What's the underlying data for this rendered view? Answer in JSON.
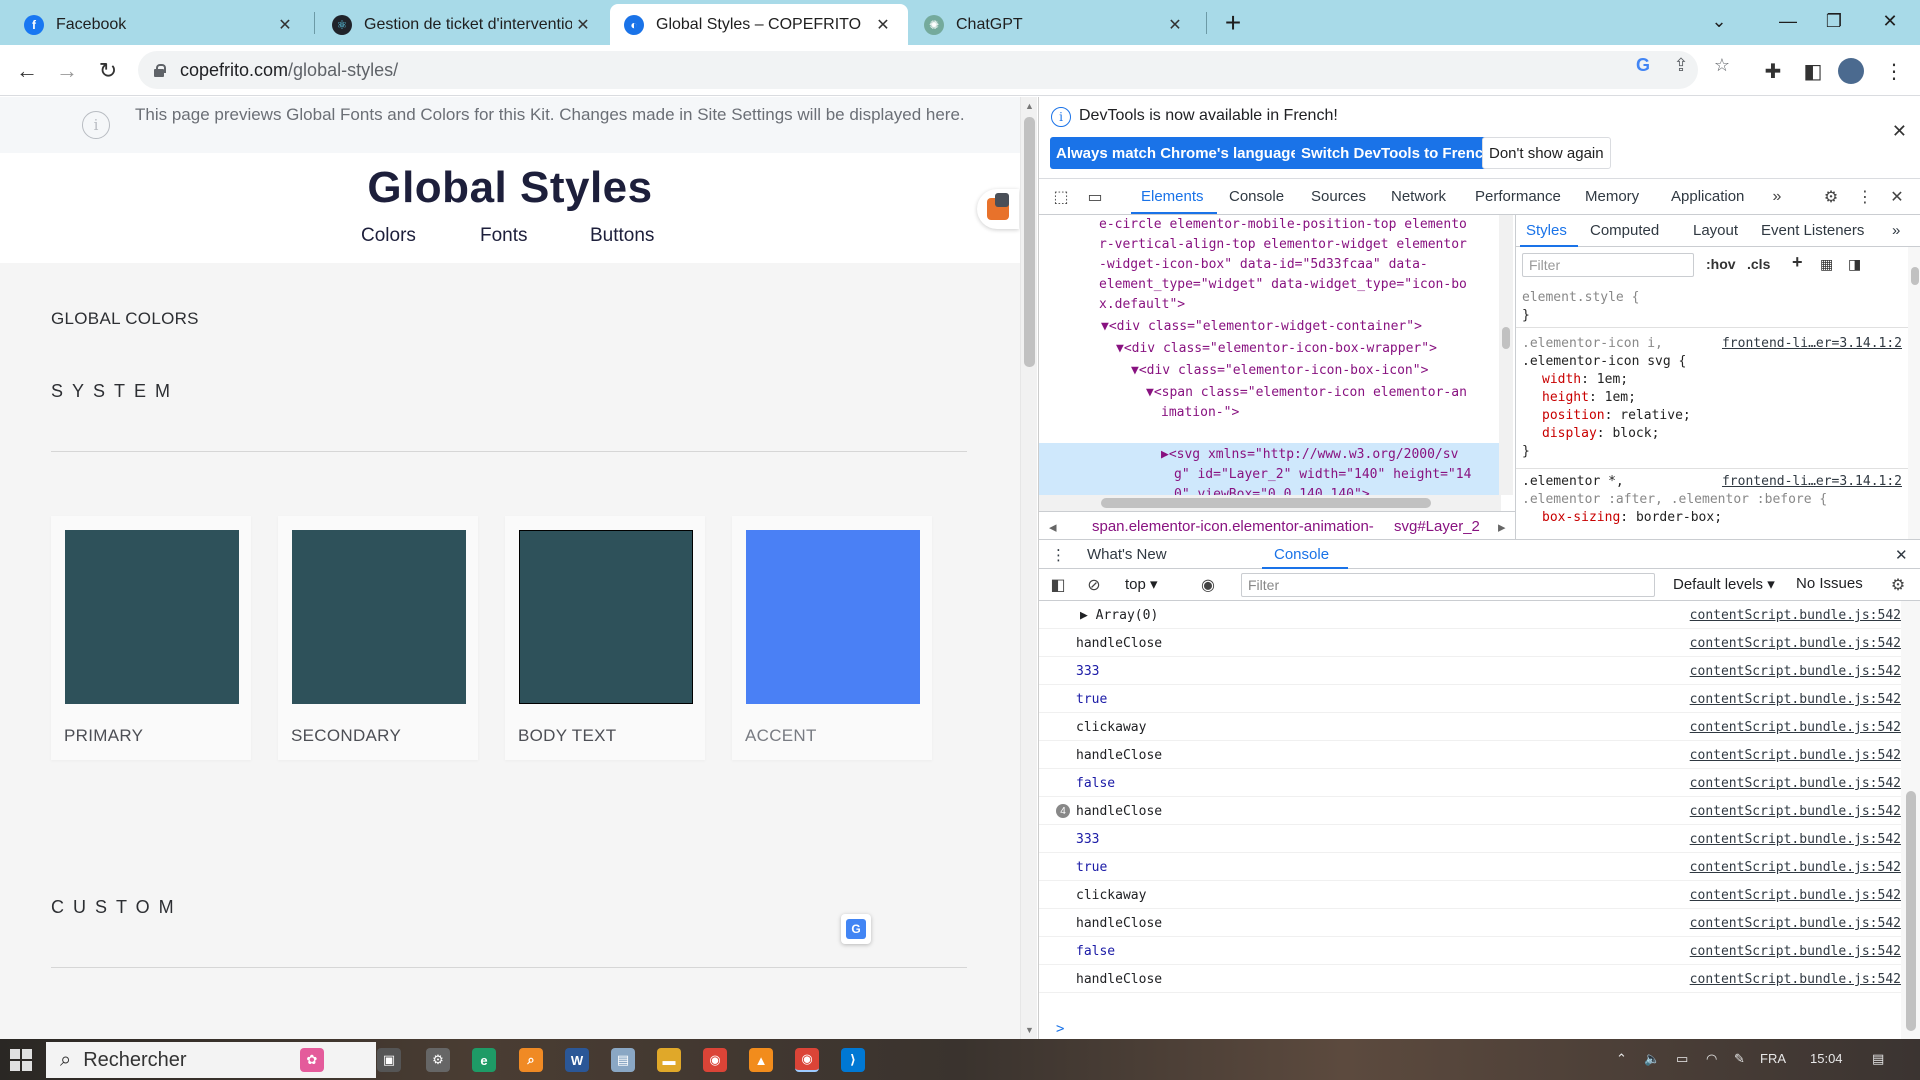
{
  "tabs": [
    {
      "title": "Facebook",
      "icon": "facebook-icon",
      "color": "#1877f2",
      "glyph": "f"
    },
    {
      "title": "Gestion de ticket d'intervention",
      "icon": "react-icon",
      "color": "#20232a",
      "glyph": "⚛"
    },
    {
      "title": "Global Styles – COPEFRITO",
      "icon": "site-icon",
      "color": "#1a73e8",
      "glyph": "◐"
    },
    {
      "title": "ChatGPT",
      "icon": "chatgpt-icon",
      "color": "#74aa9c",
      "glyph": "✺"
    }
  ],
  "toolbar": {
    "url_host": "copefrito.com",
    "url_path": "/global-styles/"
  },
  "page": {
    "notice": "This page previews Global Fonts and Colors for this Kit. Changes made in Site Settings will be displayed here.",
    "title": "Global Styles",
    "nav": [
      "Colors",
      "Fonts",
      "Buttons"
    ],
    "global_colors": "GLOBAL COLORS",
    "system": "SYSTEM",
    "custom": "CUSTOM",
    "swatches": [
      {
        "label": "PRIMARY",
        "color": "#2e515a"
      },
      {
        "label": "SECONDARY",
        "color": "#2e515a"
      },
      {
        "label": "BODY TEXT",
        "color": "#2e515a"
      },
      {
        "label": "ACCENT",
        "color": "#4a80f5"
      }
    ]
  },
  "devtools": {
    "banner": "DevTools is now available in French!",
    "btn_match": "Always match Chrome's language",
    "btn_switch": "Switch DevTools to French",
    "btn_dont": "Don't show again",
    "tabs": [
      "Elements",
      "Console",
      "Sources",
      "Network",
      "Performance",
      "Memory",
      "Application"
    ],
    "styles_tabs": [
      "Styles",
      "Computed",
      "Layout",
      "Event Listeners"
    ],
    "styles_filter": "Filter",
    "hov": ":hov",
    "cls": ".cls",
    "element_style": "element.style {",
    "close_brace": "}",
    "rule1_sel1": ".elementor-icon i,",
    "rule1_sel2": ".elementor-icon svg {",
    "rule1_src": "frontend-li…er=3.14.1:2",
    "rule1_props": [
      {
        "p": "width",
        "v": "1em;"
      },
      {
        "p": "height",
        "v": "1em;"
      },
      {
        "p": "position",
        "v": "relative;"
      },
      {
        "p": "display",
        "v": "block;"
      }
    ],
    "rule2_sel1": ".elementor *,",
    "rule2_sel2": ".elementor :after, .elementor :before {",
    "rule2_src": "frontend-li…er=3.14.1:2",
    "rule2_prop": "box-sizing",
    "rule2_val": "border-box;",
    "breadcrumb1": "span.elementor-icon.elementor-animation-",
    "breadcrumb2": "svg#Layer_2",
    "drawer_tabs": [
      "What's New",
      "Console"
    ],
    "context": "top",
    "console_filter": "Filter",
    "levels": "Default levels",
    "no_issues": "No Issues",
    "elements_lines": [
      {
        "t": "e-circle elementor-mobile-position-top elemento",
        "k": "val"
      },
      {
        "t": "r-vertical-align-top elementor-widget elementor",
        "k": "val"
      },
      {
        "t": "-widget-icon-box\" data-id=\"5d33fcaa\" data-",
        "k": "val"
      },
      {
        "t": "element_type=\"widget\" data-widget_type=\"icon-bo",
        "k": "val"
      },
      {
        "t": "x.default\">",
        "k": "val"
      },
      {
        "t": "▼<div class=\"elementor-widget-container\">",
        "k": "tag"
      },
      {
        "t": "▼<div class=\"elementor-icon-box-wrapper\">",
        "k": "tag"
      },
      {
        "t": "▼<div class=\"elementor-icon-box-icon\">",
        "k": "tag"
      },
      {
        "t": "▼<span class=\"elementor-icon elementor-an",
        "k": "tag"
      },
      {
        "t": "imation-\">",
        "k": "tag"
      },
      {
        "t": "▶<svg xmlns=\"http://www.w3.org/2000/sv",
        "k": "tag"
      },
      {
        "t": "g\" id=\"Layer_2\" width=\"140\" height=\"14",
        "k": "tag"
      },
      {
        "t": "0\" viewBox=\"0 0 140 140\">…",
        "k": "tag"
      }
    ],
    "log": [
      {
        "msg": "▶ Array(0)",
        "kw": false,
        "count": ""
      },
      {
        "msg": "handleClose",
        "kw": false,
        "count": ""
      },
      {
        "msg": "333",
        "kw": true,
        "count": ""
      },
      {
        "msg": "true",
        "kw": true,
        "count": ""
      },
      {
        "msg": "clickaway",
        "kw": false,
        "count": ""
      },
      {
        "msg": "handleClose",
        "kw": false,
        "count": ""
      },
      {
        "msg": "false",
        "kw": true,
        "count": ""
      },
      {
        "msg": "handleClose",
        "kw": false,
        "count": "4"
      },
      {
        "msg": "333",
        "kw": true,
        "count": ""
      },
      {
        "msg": "true",
        "kw": true,
        "count": ""
      },
      {
        "msg": "clickaway",
        "kw": false,
        "count": ""
      },
      {
        "msg": "handleClose",
        "kw": false,
        "count": ""
      },
      {
        "msg": "false",
        "kw": true,
        "count": ""
      },
      {
        "msg": "handleClose",
        "kw": false,
        "count": ""
      }
    ],
    "log_source": "contentScript.bundle.js:542",
    "prompt": ">"
  },
  "taskbar": {
    "search": "Rechercher",
    "lang": "FRA",
    "time": "15:04"
  }
}
